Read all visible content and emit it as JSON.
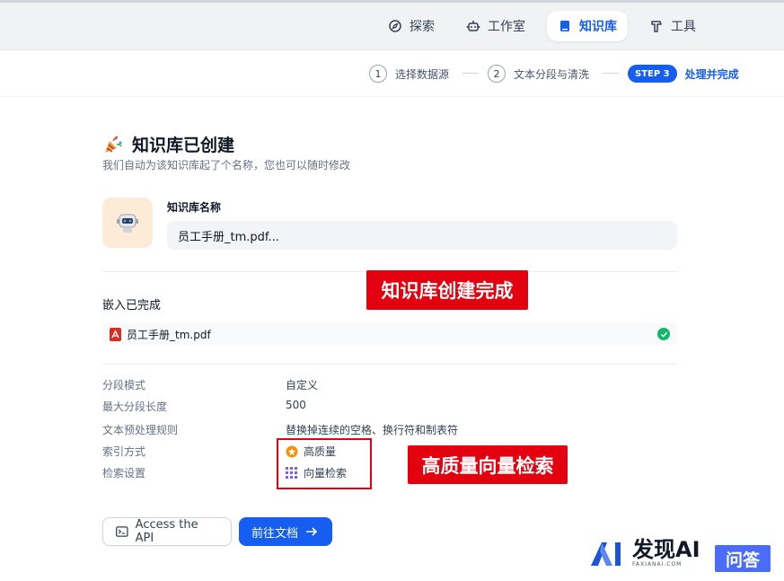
{
  "nav": {
    "explore": "探索",
    "studio": "工作室",
    "knowledge": "知识库",
    "tools": "工具"
  },
  "steps": [
    {
      "num": "1",
      "label": "选择数据源"
    },
    {
      "num": "2",
      "label": "文本分段与清洗"
    },
    {
      "num": "STEP 3",
      "label": "处理并完成"
    }
  ],
  "header": {
    "title": "知识库已创建",
    "subtitle": "我们自动为该知识库起了个名称，您也可以随时修改"
  },
  "kb_name": {
    "label": "知识库名称",
    "value": "员工手册_tm.pdf..."
  },
  "embedding": {
    "title": "嵌入已完成",
    "file": "员工手册_tm.pdf"
  },
  "properties": [
    {
      "key": "分段模式",
      "value": "自定义"
    },
    {
      "key": "最大分段长度",
      "value": "500"
    },
    {
      "key": "文本预处理规则",
      "value": "替换掉连续的空格、换行符和制表符"
    },
    {
      "key": "索引方式",
      "value": "高质量"
    },
    {
      "key": "检索设置",
      "value": "向量检索"
    }
  ],
  "annotations": {
    "created": "知识库创建完成",
    "vector": "高质量向量检索"
  },
  "buttons": {
    "api": "Access the API",
    "docs": "前往文档"
  },
  "watermark": {
    "brand": "发现AI",
    "sub": "FAXIANAI.COM",
    "qa": "问答"
  },
  "colors": {
    "accent": "#155eef",
    "success": "#12b76a",
    "annotation_red": "#e3000f"
  }
}
